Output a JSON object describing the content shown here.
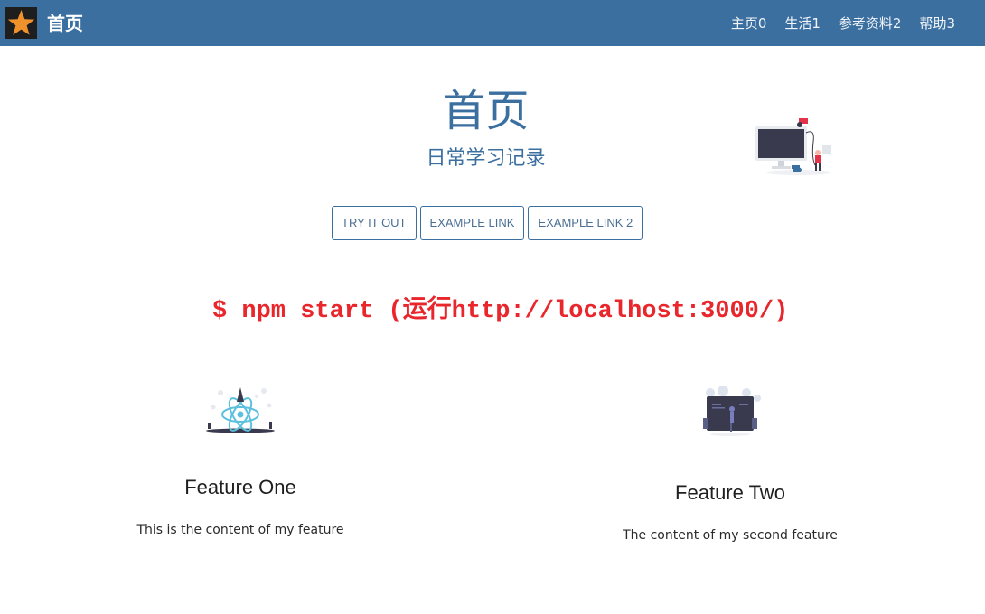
{
  "navbar": {
    "brand": "首页",
    "links": [
      {
        "label": "主页0"
      },
      {
        "label": "生活1"
      },
      {
        "label": "参考资料2"
      },
      {
        "label": "帮助3"
      }
    ],
    "background": "#3a6fa0"
  },
  "hero": {
    "title": "首页",
    "subtitle": "日常学习记录",
    "buttons": [
      {
        "label": "TRY IT OUT"
      },
      {
        "label": "EXAMPLE LINK"
      },
      {
        "label": "EXAMPLE LINK 2"
      }
    ]
  },
  "command": {
    "text": "$ npm start (运行http://localhost:3000/)",
    "color": "#e8262c"
  },
  "features": [
    {
      "title": "Feature One",
      "text": "This is the content of my feature",
      "icon": "react-atom-illustration"
    },
    {
      "title": "Feature Two",
      "text": "The content of my second feature",
      "icon": "monitor-presentation-illustration"
    }
  ]
}
